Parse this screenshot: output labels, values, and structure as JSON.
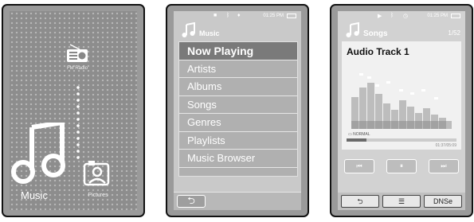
{
  "screen1": {
    "fm_radio_label": "FM Radio",
    "music_label": "Music",
    "pictures_label": "Pictures"
  },
  "screen2": {
    "status_time": "01:25 PM",
    "title": "Music",
    "menu_items": [
      "Now Playing",
      "Artists",
      "Albums",
      "Songs",
      "Genres",
      "Playlists",
      "Music Browser"
    ],
    "selected_index": 0,
    "back_glyph": "⮌"
  },
  "screen3": {
    "status_time": "01:25 PM",
    "title": "Songs",
    "track_count": "1/52",
    "track_title": "Audio Track 1",
    "eq_mode": "NORMAL",
    "elapsed_total": "01:37/05:09",
    "progress": 0.18,
    "prev_glyph": "⏮",
    "pause_glyph": "⏸",
    "next_glyph": "⏭",
    "back_glyph": "⮌",
    "menu_glyph": "☰",
    "dnse_label": "DNSe"
  }
}
